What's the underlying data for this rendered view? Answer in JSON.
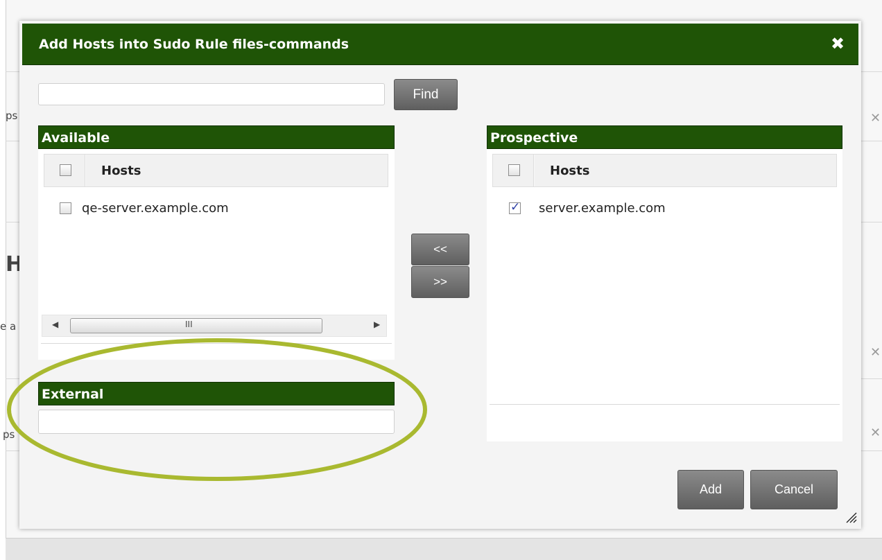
{
  "dialog": {
    "title": "Add Hosts into Sudo Rule files-commands",
    "close_icon": "close-icon"
  },
  "search": {
    "value": "",
    "placeholder": "",
    "find_label": "Find"
  },
  "available": {
    "header": "Available",
    "column_header": "Hosts",
    "rows": [
      {
        "label": "qe-server.example.com",
        "checked": false
      }
    ],
    "scrollbar_grip": "III"
  },
  "transfer": {
    "move_left_label": "<<",
    "move_right_label": ">>"
  },
  "prospective": {
    "header": "Prospective",
    "column_header": "Hosts",
    "rows": [
      {
        "label": "server.example.com",
        "checked": true
      }
    ]
  },
  "external": {
    "header": "External",
    "value": ""
  },
  "footer": {
    "add_label": "Add",
    "cancel_label": "Cancel"
  },
  "background": {
    "partial_texts": [
      "ps",
      "H",
      "e a",
      "ps"
    ]
  },
  "annotation": {
    "color": "#a9b930"
  },
  "colors": {
    "header_green": "#1f5406",
    "button_gray": "#6f6f6f"
  }
}
